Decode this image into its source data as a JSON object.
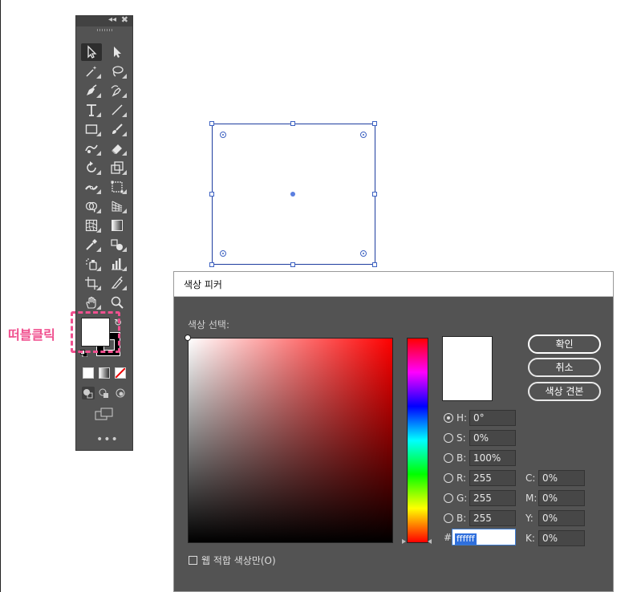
{
  "toolbar": {
    "collapse_glyph": "◂◂",
    "close_glyph": "✖",
    "more_label": "•••",
    "tools": [
      {
        "name": "selection-tool",
        "active": true
      },
      {
        "name": "direct-selection-tool"
      },
      {
        "name": "magic-wand-tool"
      },
      {
        "name": "lasso-tool"
      },
      {
        "name": "pen-tool"
      },
      {
        "name": "curvature-tool"
      },
      {
        "name": "type-tool"
      },
      {
        "name": "line-tool"
      },
      {
        "name": "rectangle-tool"
      },
      {
        "name": "paintbrush-tool"
      },
      {
        "name": "shaper-tool"
      },
      {
        "name": "eraser-tool"
      },
      {
        "name": "rotate-tool"
      },
      {
        "name": "scale-tool"
      },
      {
        "name": "width-tool"
      },
      {
        "name": "free-transform-tool"
      },
      {
        "name": "shape-builder-tool"
      },
      {
        "name": "perspective-grid-tool"
      },
      {
        "name": "mesh-tool"
      },
      {
        "name": "gradient-tool"
      },
      {
        "name": "eyedropper-tool"
      },
      {
        "name": "blend-tool"
      },
      {
        "name": "symbol-sprayer-tool"
      },
      {
        "name": "column-graph-tool"
      },
      {
        "name": "artboard-tool"
      },
      {
        "name": "slice-tool"
      },
      {
        "name": "hand-tool"
      },
      {
        "name": "zoom-tool"
      }
    ],
    "fill_color": "#ffffff",
    "stroke_color": "#000000"
  },
  "annotation": {
    "label": "떠블클릭",
    "color": "#f0508f"
  },
  "dialog": {
    "title": "색상 피커",
    "select_label": "색상 선택:",
    "buttons": {
      "ok": "확인",
      "cancel": "취소",
      "swatches": "색상 견본"
    },
    "hsb": [
      {
        "label": "H:",
        "value": "0°",
        "checked": true
      },
      {
        "label": "S:",
        "value": "0%"
      },
      {
        "label": "B:",
        "value": "100%"
      }
    ],
    "rgb": [
      {
        "label": "R:",
        "value": "255"
      },
      {
        "label": "G:",
        "value": "255"
      },
      {
        "label": "B:",
        "value": "255"
      }
    ],
    "cmyk": [
      {
        "label": "C:",
        "value": "0%"
      },
      {
        "label": "M:",
        "value": "0%"
      },
      {
        "label": "Y:",
        "value": "0%"
      },
      {
        "label": "K:",
        "value": "0%"
      }
    ],
    "hex_label": "#",
    "hex_value": "ffffff",
    "web_only_label": "웹 적합 색상만(O)",
    "current_color": "#ffffff"
  }
}
